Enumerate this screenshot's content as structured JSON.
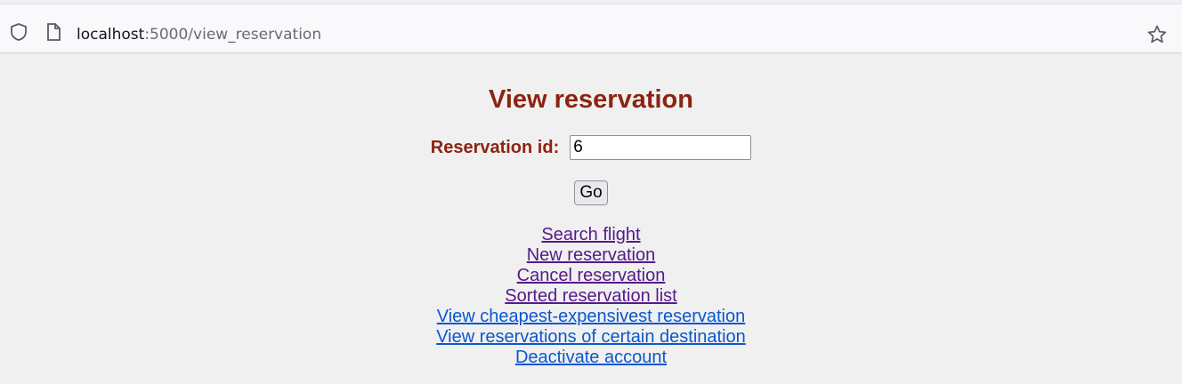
{
  "browser": {
    "url_host": "localhost",
    "url_path": ":5000/view_reservation"
  },
  "page": {
    "title": "View reservation",
    "form": {
      "label": "Reservation id:",
      "value": "6",
      "submit_label": "Go"
    },
    "links": [
      {
        "label": "Search flight",
        "visited": true
      },
      {
        "label": "New reservation",
        "visited": true
      },
      {
        "label": "Cancel reservation",
        "visited": true
      },
      {
        "label": "Sorted reservation list",
        "visited": true
      },
      {
        "label": "View cheapest-expensivest reservation",
        "visited": false
      },
      {
        "label": "View reservations of certain destination",
        "visited": false
      },
      {
        "label": "Deactivate account",
        "visited": false
      }
    ]
  },
  "colors": {
    "heading": "#8b2412",
    "visited_link": "#551a8b",
    "link": "#0b57d0"
  },
  "icons": {
    "shield": "shield-icon",
    "page": "page-icon",
    "star": "bookmark-star-icon"
  }
}
